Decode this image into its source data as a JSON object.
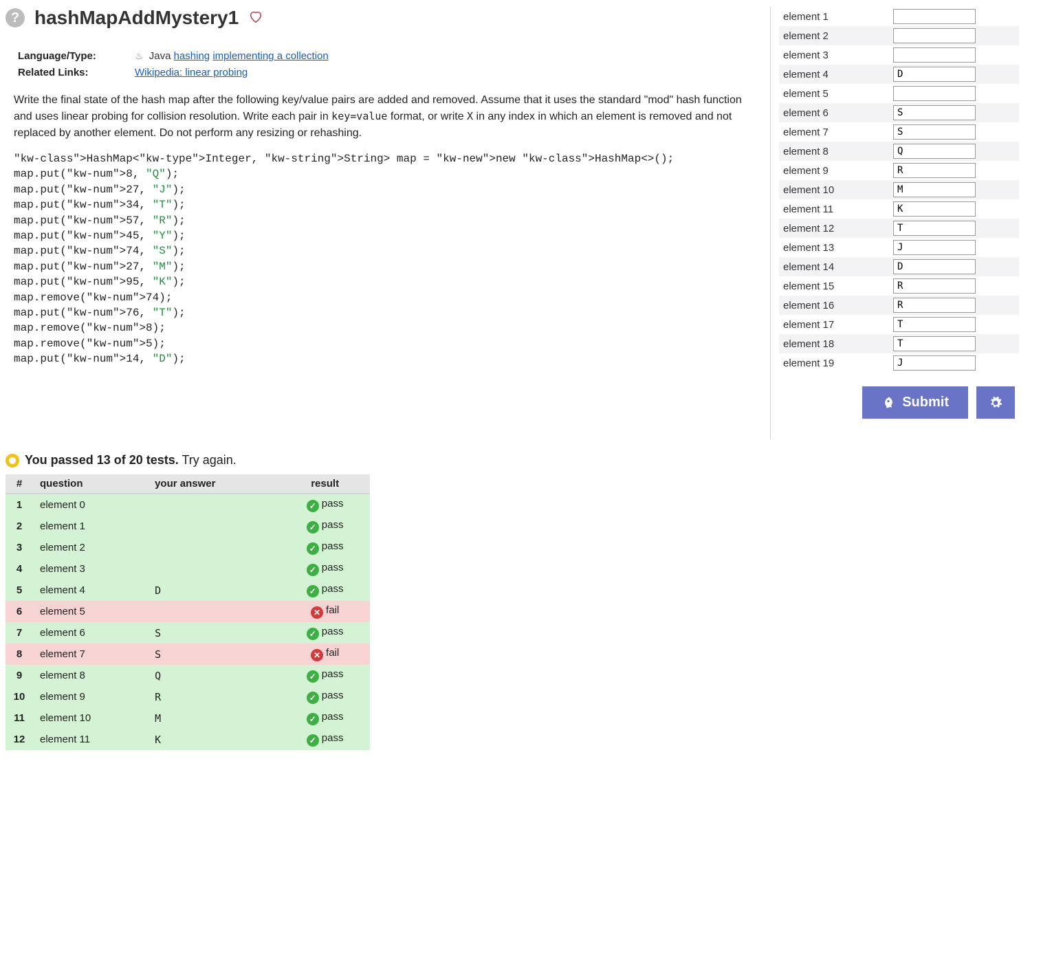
{
  "title": "hashMapAddMystery1",
  "meta": {
    "language_label": "Language/Type:",
    "language_value": "Java",
    "tags": [
      "hashing",
      "implementing a collection"
    ],
    "related_label": "Related Links:",
    "related_link": "Wikipedia: linear probing"
  },
  "problem_html": "Write the final state of the hash map after the following key/value pairs are added and removed. Assume that it uses the standard \"mod\" hash function and uses linear probing for collision resolution. Write each pair in <code>key=value</code> format, or write <code>X</code> in any index in which an element is removed and not replaced by another element. Do not perform any resizing or rehashing.",
  "code_lines": [
    "HashMap<Integer, String> map = new HashMap<>();",
    "map.put(8, \"Q\");",
    "map.put(27, \"J\");",
    "map.put(34, \"T\");",
    "map.put(57, \"R\");",
    "map.put(45, \"Y\");",
    "map.put(74, \"S\");",
    "map.put(27, \"M\");",
    "map.put(95, \"K\");",
    "map.remove(74);",
    "map.put(76, \"T\");",
    "map.remove(8);",
    "map.remove(5);",
    "map.put(14, \"D\");"
  ],
  "inputs": [
    {
      "label": "element 1",
      "value": ""
    },
    {
      "label": "element 2",
      "value": ""
    },
    {
      "label": "element 3",
      "value": ""
    },
    {
      "label": "element 4",
      "value": "D"
    },
    {
      "label": "element 5",
      "value": ""
    },
    {
      "label": "element 6",
      "value": "S"
    },
    {
      "label": "element 7",
      "value": "S"
    },
    {
      "label": "element 8",
      "value": "Q"
    },
    {
      "label": "element 9",
      "value": "R"
    },
    {
      "label": "element 10",
      "value": "M"
    },
    {
      "label": "element 11",
      "value": "K"
    },
    {
      "label": "element 12",
      "value": "T"
    },
    {
      "label": "element 13",
      "value": "J"
    },
    {
      "label": "element 14",
      "value": "D"
    },
    {
      "label": "element 15",
      "value": "R"
    },
    {
      "label": "element 16",
      "value": "R"
    },
    {
      "label": "element 17",
      "value": "T"
    },
    {
      "label": "element 18",
      "value": "T"
    },
    {
      "label": "element 19",
      "value": "J"
    }
  ],
  "submit_label": "Submit",
  "results": {
    "summary_bold": "You passed 13 of 20 tests.",
    "summary_rest": " Try again.",
    "headers": {
      "num": "#",
      "question": "question",
      "answer": "your answer",
      "result": "result"
    },
    "rows": [
      {
        "n": 1,
        "q": "element 0",
        "a": "",
        "r": "pass"
      },
      {
        "n": 2,
        "q": "element 1",
        "a": "",
        "r": "pass"
      },
      {
        "n": 3,
        "q": "element 2",
        "a": "",
        "r": "pass"
      },
      {
        "n": 4,
        "q": "element 3",
        "a": "",
        "r": "pass"
      },
      {
        "n": 5,
        "q": "element 4",
        "a": "D",
        "r": "pass"
      },
      {
        "n": 6,
        "q": "element 5",
        "a": "",
        "r": "fail"
      },
      {
        "n": 7,
        "q": "element 6",
        "a": "S",
        "r": "pass"
      },
      {
        "n": 8,
        "q": "element 7",
        "a": "S",
        "r": "fail"
      },
      {
        "n": 9,
        "q": "element 8",
        "a": "Q",
        "r": "pass"
      },
      {
        "n": 10,
        "q": "element 9",
        "a": "R",
        "r": "pass"
      },
      {
        "n": 11,
        "q": "element 10",
        "a": "M",
        "r": "pass"
      },
      {
        "n": 12,
        "q": "element 11",
        "a": "K",
        "r": "pass"
      }
    ]
  }
}
